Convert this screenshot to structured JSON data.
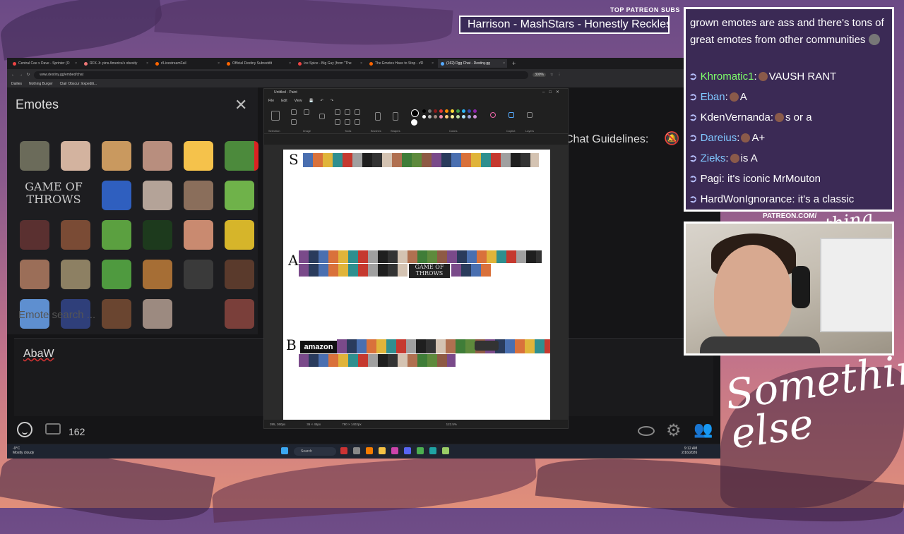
{
  "overlay": {
    "patreon_label": "TOP PATREON SUBS",
    "ticker_text": "Harrison - MashStars - Honestly Reckless",
    "patreon_url": "PATREON.COM/",
    "logo_text_small": "Anything else?",
    "logo_text_large": "Something else"
  },
  "chat": {
    "intro": "grown emotes are ass and there's tons of great emotes from other communities",
    "messages": [
      {
        "user": "Khromatic1",
        "user_color": "#7dff6a",
        "text": "VAUSH RANT",
        "emote": true
      },
      {
        "user": "Eban",
        "user_color": "#7fc7ff",
        "text": "A",
        "emote": true
      },
      {
        "user": "KdenVernanda",
        "user_color": "#ffffff",
        "text": "s or a",
        "emote": true
      },
      {
        "user": "Dareius",
        "user_color": "#7fc7ff",
        "text": "A+",
        "emote": true
      },
      {
        "user": "Zieks",
        "user_color": "#7fc7ff",
        "text": "is A",
        "emote": true
      },
      {
        "user": "Pagi",
        "user_color": "#ffffff",
        "text": "it's iconic MrMouton",
        "emote": false
      },
      {
        "user": "HardWonIgnorance",
        "user_color": "#ffffff",
        "text": "it's a classic",
        "emote": false
      }
    ]
  },
  "browser": {
    "tabs": [
      {
        "label": "Central Cee x Dave - Sprinter (O"
      },
      {
        "label": "RFK Jr. pins America's obesity"
      },
      {
        "label": "r/LivestreamFail"
      },
      {
        "label": "Official Destiny Subreddit"
      },
      {
        "label": "Ice Spice - Big Guy (from \"The"
      },
      {
        "label": "The Emotes Have to Stop - r/D"
      },
      {
        "label": "(162) Dgg Chat - Destiny.gg"
      }
    ],
    "url": "www.destiny.gg/embed/chat",
    "zoom": "300%",
    "bookmarks": [
      "Dailies",
      "Nothing Burger",
      "Clair Obscur: Expediti..."
    ]
  },
  "emotes_panel": {
    "title": "Emotes",
    "close": "✕",
    "search_placeholder": "Emote search ...",
    "game_of_thrones": "GAME OF THROWS"
  },
  "dgg_chat": {
    "input_value": "AbaW",
    "user_count": "162",
    "guidelines": "Chat Guidelines:"
  },
  "paint": {
    "title": "Untitled - Paint",
    "menu": [
      "File",
      "Edit",
      "View"
    ],
    "ribbon_labels": [
      "Selection",
      "Image",
      "Tools",
      "Brushes",
      "Shapes",
      "Colors",
      "Copilot",
      "Layers"
    ],
    "tiers": [
      "S",
      "A",
      "B"
    ],
    "amazon_label": "amazon",
    "got_label": "GAME OF THROWS",
    "status_pos": "395, 360px",
    "status_sel": "36 × 45px",
    "status_size": "780 × 1402px",
    "status_zoom": "122.5%"
  },
  "taskbar": {
    "weather_temp": "-9°C",
    "weather_desc": "Mostly cloudy",
    "search": "Search",
    "time": "9:12 AM",
    "date": "2/16/2026"
  },
  "colors": {
    "panel_bg": "#1d1d20",
    "chat_bg": "#3b2a55",
    "accent_green": "#7dff6a",
    "accent_blue": "#7fc7ff"
  }
}
